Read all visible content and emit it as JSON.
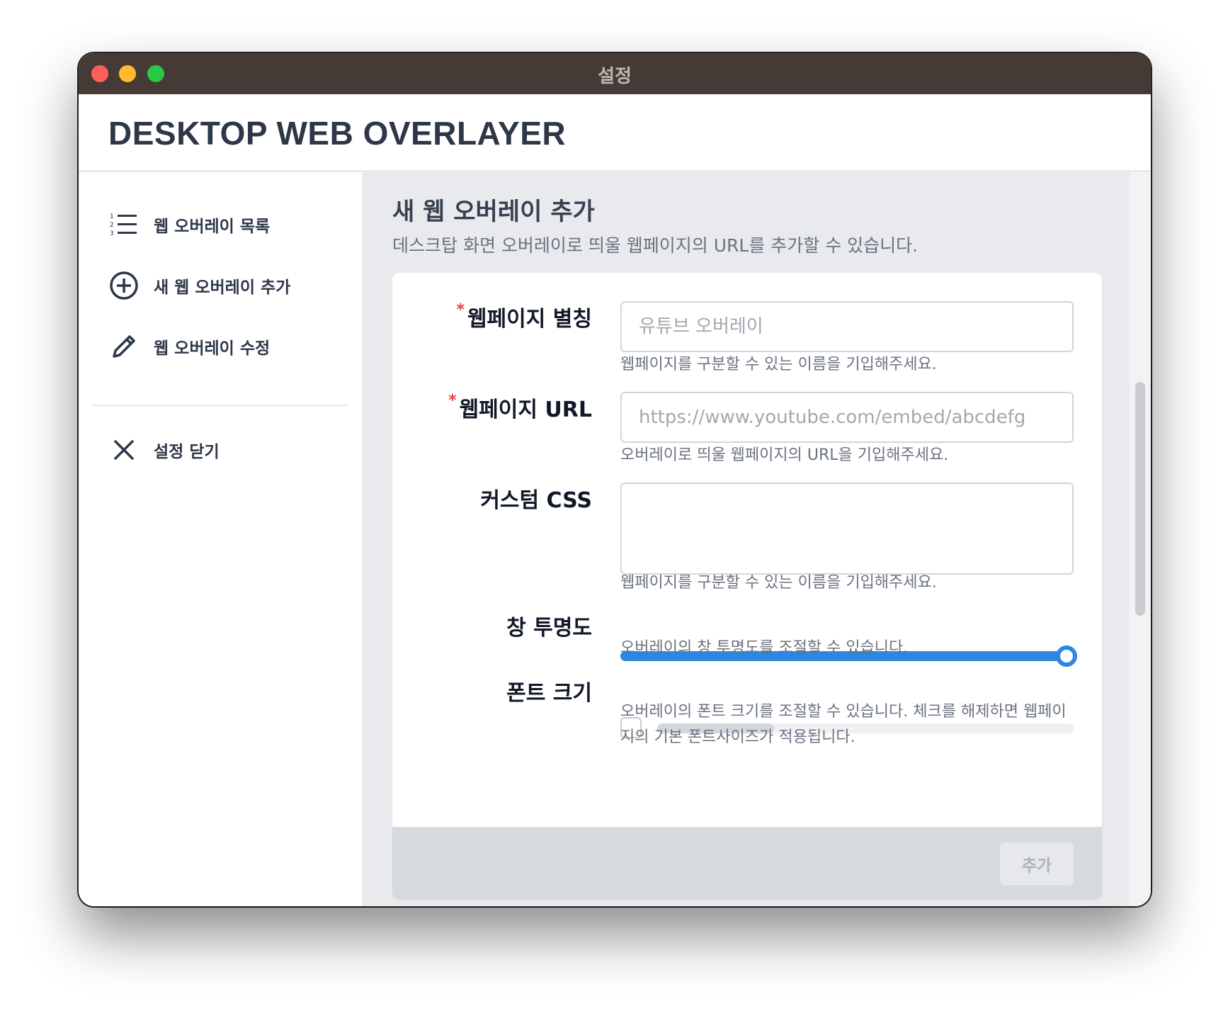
{
  "window": {
    "title": "설정"
  },
  "app": {
    "brand": "DESKTOP WEB OVERLAYER"
  },
  "sidebar": {
    "items": [
      {
        "label": "웹 오버레이 목록",
        "icon": "list-icon"
      },
      {
        "label": "새 웹 오버레이 추가",
        "icon": "plus-circle-icon"
      },
      {
        "label": "웹 오버레이 수정",
        "icon": "pencil-icon"
      },
      {
        "label": "설정 닫기",
        "icon": "close-icon"
      }
    ]
  },
  "main": {
    "title": "새 웹 오버레이 추가",
    "subtitle": "데스크탑 화면 오버레이로 띄울 웹페이지의 URL를 추가할 수 있습니다."
  },
  "form": {
    "alias": {
      "required_mark": "*",
      "label": "웹페이지 별칭",
      "value": "",
      "placeholder": "유튜브 오버레이",
      "help": "웹페이지를 구분할 수 있는 이름을 기입해주세요."
    },
    "url": {
      "required_mark": "*",
      "label": "웹페이지 URL",
      "value": "",
      "placeholder": "https://www.youtube.com/embed/abcdefg",
      "help": "오버레이로 띄울 웹페이지의 URL을 기입해주세요."
    },
    "css": {
      "label": "커스텀 CSS",
      "value": "",
      "help": "웹페이지를 구분할 수 있는 이름을 기입해주세요."
    },
    "opacity": {
      "label": "창 투명도",
      "value": 1.0,
      "help": "오버레이의 창 투명도를 조절할 수 있습니다."
    },
    "font_size": {
      "label": "폰트 크기",
      "enabled": false,
      "value": 0.28,
      "help": "오버레이의 폰트 크기를 조절할 수 있습니다. 체크를 해제하면 웹페이지의 기본 폰트사이즈가 적용됩니다."
    },
    "submit_label": "추가"
  },
  "colors": {
    "titlebar": "#453a36",
    "accent": "#2b87e0",
    "required": "#e53e3e"
  }
}
